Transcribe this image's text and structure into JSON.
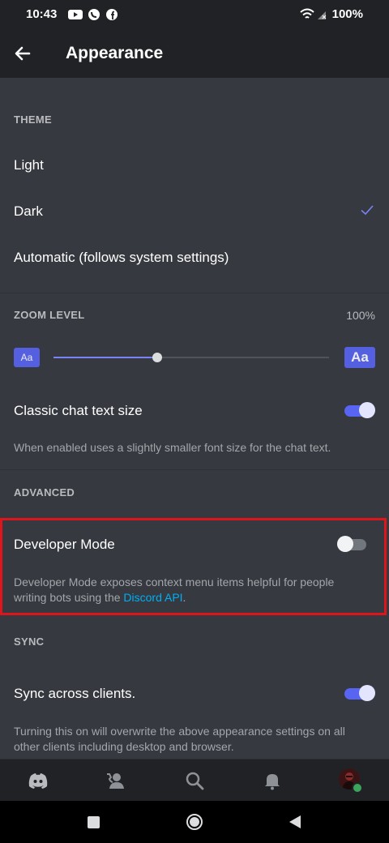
{
  "status_bar": {
    "time": "10:43",
    "battery": "100%"
  },
  "app_bar": {
    "title": "Appearance"
  },
  "theme": {
    "header": "THEME",
    "options": [
      {
        "label": "Light",
        "selected": false
      },
      {
        "label": "Dark",
        "selected": true
      },
      {
        "label": "Automatic (follows system settings)",
        "selected": false
      }
    ]
  },
  "zoom": {
    "header": "ZOOM LEVEL",
    "value": "100%",
    "small_label": "Aa",
    "large_label": "Aa",
    "slider_fraction": 0.375
  },
  "classic_chat": {
    "label": "Classic chat text size",
    "enabled": true,
    "description": "When enabled uses a slightly smaller font size for the chat text."
  },
  "advanced": {
    "header": "ADVANCED",
    "developer_mode": {
      "label": "Developer Mode",
      "enabled": false,
      "description_prefix": "Developer Mode exposes context menu items helpful for people writing bots using the ",
      "link_text": "Discord API",
      "description_suffix": "."
    }
  },
  "sync": {
    "header": "SYNC",
    "label": "Sync across clients.",
    "enabled": true,
    "description": "Turning this on will overwrite the above appearance settings on all other clients including desktop and browser."
  },
  "bottom_nav": [
    "discord-home-icon",
    "friends-icon",
    "search-icon",
    "notifications-bell-icon",
    "user-avatar"
  ],
  "colors": {
    "accent": "#5865f2",
    "highlight": "#e0151b",
    "link": "#00aff4",
    "online": "#3ba55c"
  }
}
